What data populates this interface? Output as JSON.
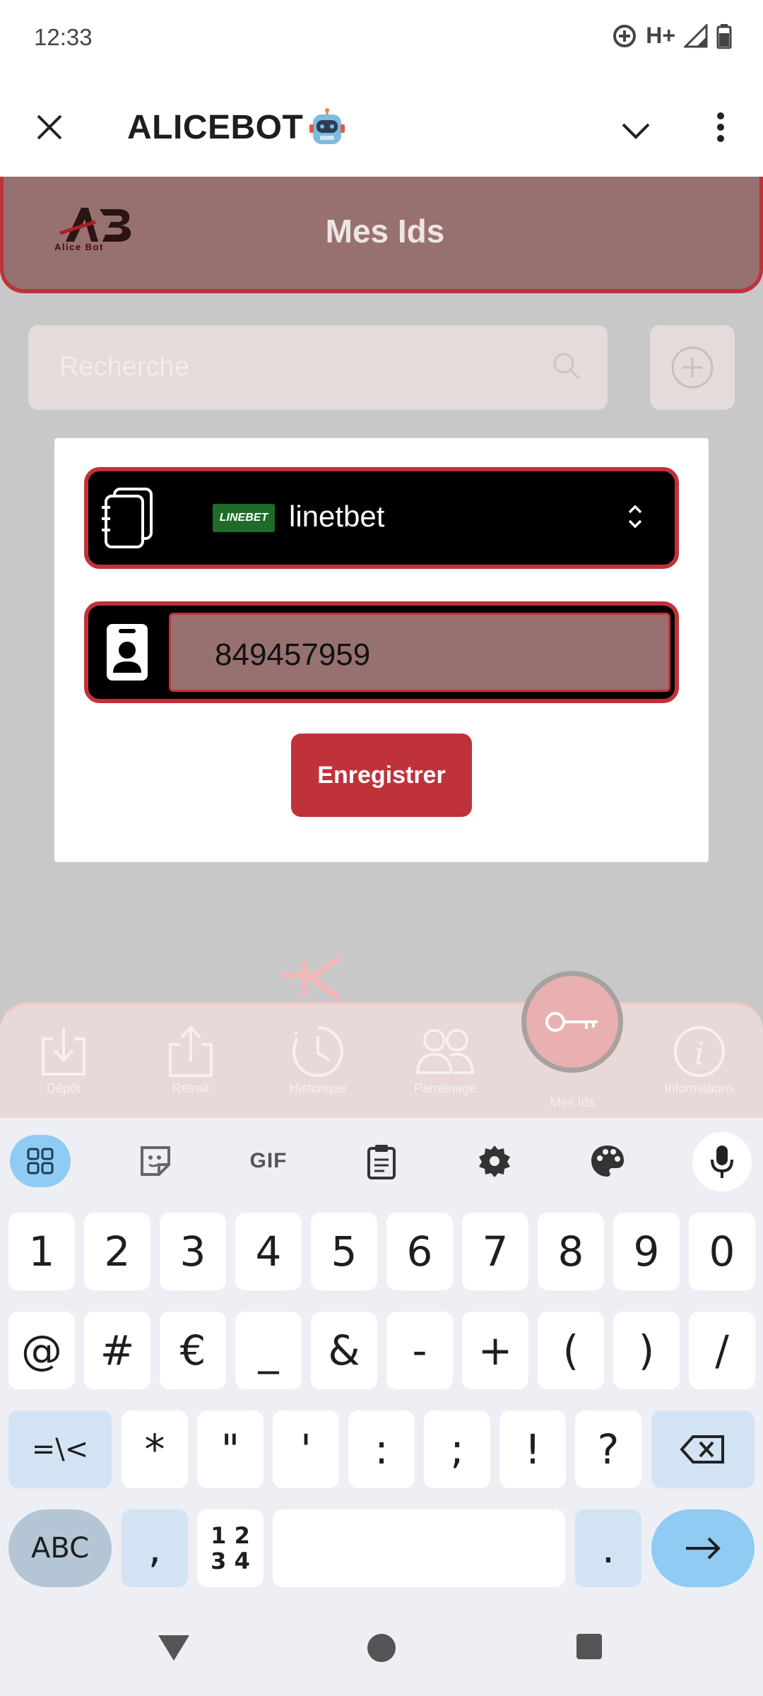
{
  "status_bar": {
    "time": "12:33",
    "network": "H+"
  },
  "app_bar": {
    "title": "ALICEBOT"
  },
  "web": {
    "logo_text": "Alice Bot",
    "page_title": "Mes Ids",
    "search_placeholder": "Recherche",
    "bookmaker_logo": "LINEBET",
    "selected_bookmaker": "linetbet",
    "id_value": "849457959",
    "save_label": "Enregistrer"
  },
  "bottom_nav": {
    "items": [
      {
        "label": "Dépôt",
        "icon": "download-icon"
      },
      {
        "label": "Retrait",
        "icon": "upload-icon"
      },
      {
        "label": "Historique",
        "icon": "history-clock-icon"
      },
      {
        "label": "Parrainage",
        "icon": "users-icon"
      },
      {
        "label": "Mes Ids",
        "icon": "key-icon"
      },
      {
        "label": "Informations",
        "icon": "info-icon"
      }
    ]
  },
  "keyboard": {
    "toolbar": {
      "gif": "GIF"
    },
    "row1": [
      "1",
      "2",
      "3",
      "4",
      "5",
      "6",
      "7",
      "8",
      "9",
      "0"
    ],
    "row2": [
      "@",
      "#",
      "€",
      "_",
      "&",
      "-",
      "+",
      "(",
      ")",
      "/"
    ],
    "row3": [
      "=\\<",
      "*",
      "\"",
      "'",
      ":",
      ";",
      "!",
      "?"
    ],
    "row4": {
      "abc": "ABC",
      "comma": ",",
      "num_top": "1 2",
      "num_bottom": "3 4",
      "period": "."
    }
  },
  "colors": {
    "accent": "#c0323a",
    "header": "#977170",
    "keyboard_bg": "#edeff5",
    "key_blue": "#8fcbf3"
  }
}
